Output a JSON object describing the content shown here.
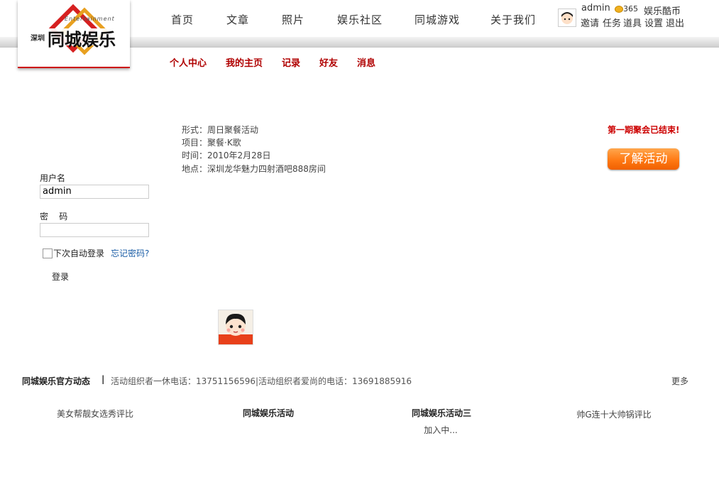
{
  "logo": {
    "subtitle": "Entertainment",
    "small": "深圳",
    "main": "同城娱乐"
  },
  "nav": [
    {
      "label": "首页"
    },
    {
      "label": "文章"
    },
    {
      "label": "照片"
    },
    {
      "label": "娱乐社区"
    },
    {
      "label": "同城游戏"
    },
    {
      "label": "关于我们"
    }
  ],
  "user": {
    "name": "admin",
    "coins": "365",
    "coin_label": "娱乐酷币",
    "links": [
      "邀请",
      "任务",
      "道具",
      "设置",
      "退出"
    ]
  },
  "subnav": [
    "个人中心",
    "我的主页",
    "记录",
    "好友",
    "消息"
  ],
  "activity": {
    "form": "形式：周日聚餐活动",
    "project": "项目：聚餐·K歌",
    "time": "时间：2010年2月28日",
    "place": "地点：深圳龙华魅力四射酒吧888房间",
    "status": "第一期聚会已结束!",
    "button": "了解活动"
  },
  "login": {
    "username_label": "用户名",
    "username_value": "admin",
    "password_label": "密    码",
    "remember_label": "下次自动登录",
    "forgot": "忘记密码?",
    "submit": "登录"
  },
  "news": {
    "title": "同城娱乐官方动态",
    "separator": "|",
    "text": "活动组织者一休电话：13751156596|活动组织者爱尚的电话：13691885916",
    "more": "更多"
  },
  "features": [
    {
      "label": "美女帮靓女选秀评比"
    },
    {
      "label": "同城娱乐活动"
    },
    {
      "label": "同城娱乐活动三",
      "sub": "加入中..."
    },
    {
      "label": "帅G连十大帅锅评比"
    }
  ]
}
